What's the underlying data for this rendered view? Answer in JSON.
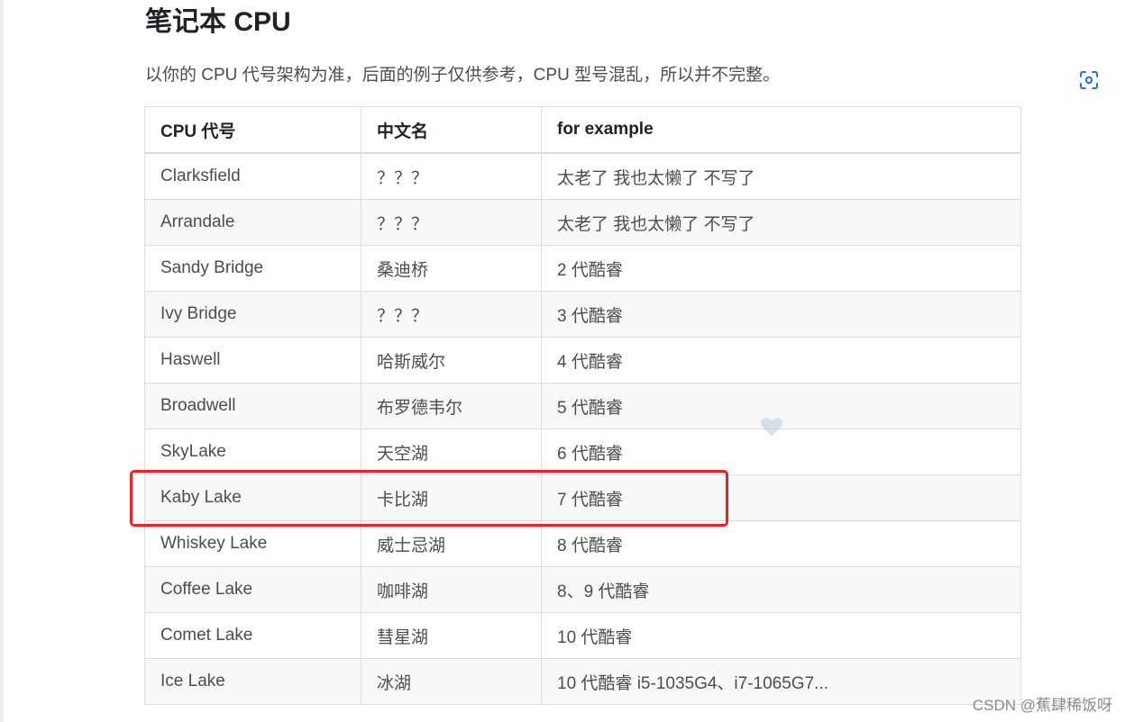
{
  "section_title": "笔记本 CPU",
  "intro_text": "以你的 CPU 代号架构为准，后面的例子仅供参考，CPU 型号混乱，所以并不完整。",
  "scan_button_icon": "scan-icon",
  "table": {
    "headers": [
      "CPU 代号",
      "中文名",
      "for example"
    ],
    "rows": [
      [
        "Clarksfield",
        "？？？",
        "太老了 我也太懒了 不写了"
      ],
      [
        "Arrandale",
        "？？？",
        "太老了 我也太懒了 不写了"
      ],
      [
        "Sandy Bridge",
        "桑迪桥",
        "2 代酷睿"
      ],
      [
        "Ivy Bridge",
        "？？？",
        "3 代酷睿"
      ],
      [
        "Haswell",
        "哈斯威尔",
        "4 代酷睿"
      ],
      [
        "Broadwell",
        "布罗德韦尔",
        "5 代酷睿"
      ],
      [
        "SkyLake",
        "天空湖",
        "6 代酷睿"
      ],
      [
        "Kaby Lake",
        "卡比湖",
        "7 代酷睿"
      ],
      [
        "Whiskey Lake",
        "威士忌湖",
        "8 代酷睿"
      ],
      [
        "Coffee Lake",
        "咖啡湖",
        "8、9 代酷睿"
      ],
      [
        "Comet Lake",
        "彗星湖",
        "10 代酷睿"
      ],
      [
        "Ice Lake",
        "冰湖",
        "10 代酷睿 i5-1035G4、i7-1065G7..."
      ]
    ]
  },
  "highlighted_row": "Kaby Lake",
  "highlight_color": "#ee2222",
  "heart_icon": "heart-icon",
  "heart_color": "#b7cde0",
  "watermark": "CSDN @蕉肆稀饭呀"
}
